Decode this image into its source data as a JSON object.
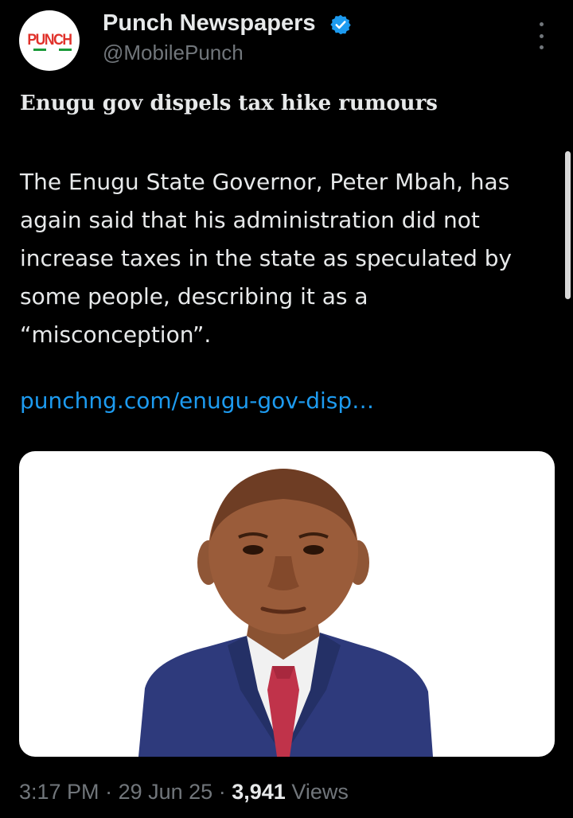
{
  "tweet": {
    "avatar_logo_text": "PUNCH",
    "author_name": "Punch Newspapers",
    "author_handle": "@MobilePunch",
    "headline": "Enugu gov dispels tax hike rumours",
    "body": "The Enugu State Governor, Peter Mbah, has again said that his administration did not increase taxes in the state as speculated by some people, describing it as a “misconception”.",
    "link_text": "punchng.com/enugu-gov-disp…",
    "time": "3:17 PM",
    "date": "29 Jun 25",
    "views_count": "3,941",
    "views_label": "Views",
    "separator": "·"
  },
  "icons": {
    "verified": "verified-badge-icon",
    "more": "more-options-icon"
  },
  "colors": {
    "background": "#000000",
    "text_primary": "#e7e9ea",
    "text_secondary": "#71767b",
    "link": "#1d9bf0",
    "verified": "#1d9bf0",
    "punch_red": "#e0312a"
  }
}
